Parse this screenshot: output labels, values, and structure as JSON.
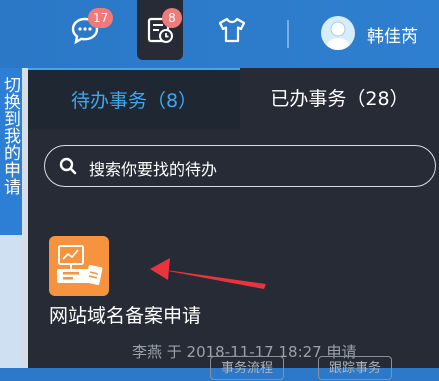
{
  "header": {
    "messages_badge": "17",
    "tasks_badge": "8",
    "username": "韩佳芮"
  },
  "background_page": {
    "vertical_text": "切换到我的申请"
  },
  "panel": {
    "tabs": [
      {
        "label": "待办事务（8）",
        "active": true
      },
      {
        "label": "已办事务（28）",
        "active": false
      }
    ],
    "search_placeholder": "搜索你要找的待办",
    "item": {
      "title": "网站域名备案申请",
      "meta": "李燕 于 2018-11-17 18:27 申请",
      "buttons": [
        "事务流程",
        "跟踪事务"
      ]
    }
  },
  "colors": {
    "header_blue": "#2a78c6",
    "panel_bg": "#262b36",
    "tab_active_text": "#3ea7f2",
    "badge_red": "#f07a79",
    "app_icon_orange": "#f5933e",
    "arrow_red": "#e8343c"
  }
}
